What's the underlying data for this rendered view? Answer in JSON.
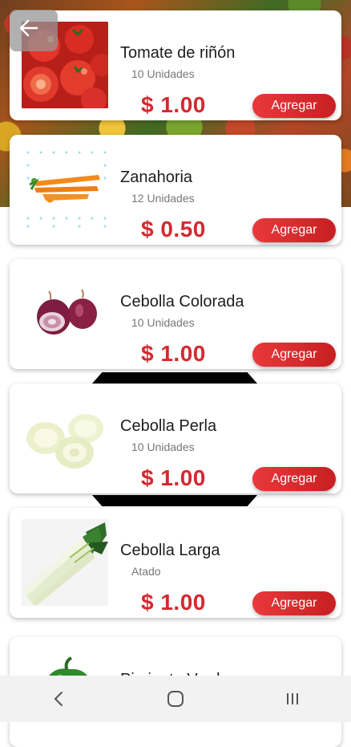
{
  "products": [
    {
      "name": "Tomate de riñón",
      "quantity": "10 Unidades",
      "price": "$ 1.00",
      "button": "Agregar",
      "image": "tomatoes"
    },
    {
      "name": "Zanahoria",
      "quantity": "12 Unidades",
      "price": "$ 0.50",
      "button": "Agregar",
      "image": "carrots"
    },
    {
      "name": "Cebolla Colorada",
      "quantity": "10 Unidades",
      "price": "$ 1.00",
      "button": "Agregar",
      "image": "red-onion"
    },
    {
      "name": "Cebolla Perla",
      "quantity": "10 Unidades",
      "price": "$ 1.00",
      "button": "Agregar",
      "image": "pearl-onion"
    },
    {
      "name": "Cebolla Larga",
      "quantity": "Atado",
      "price": "$ 1.00",
      "button": "Agregar",
      "image": "green-onion"
    },
    {
      "name": "Pimiento Verde",
      "image": "green-pepper"
    }
  ],
  "icons": {
    "back": "arrow-left-icon",
    "nav_back": "chevron-left-icon",
    "nav_home": "home-icon",
    "nav_recents": "recents-icon"
  },
  "colors": {
    "accent": "#d32a2f",
    "button_gradient_start": "#e8393b",
    "button_gradient_end": "#c71f22",
    "navbar_bg": "#f2f2f2"
  }
}
